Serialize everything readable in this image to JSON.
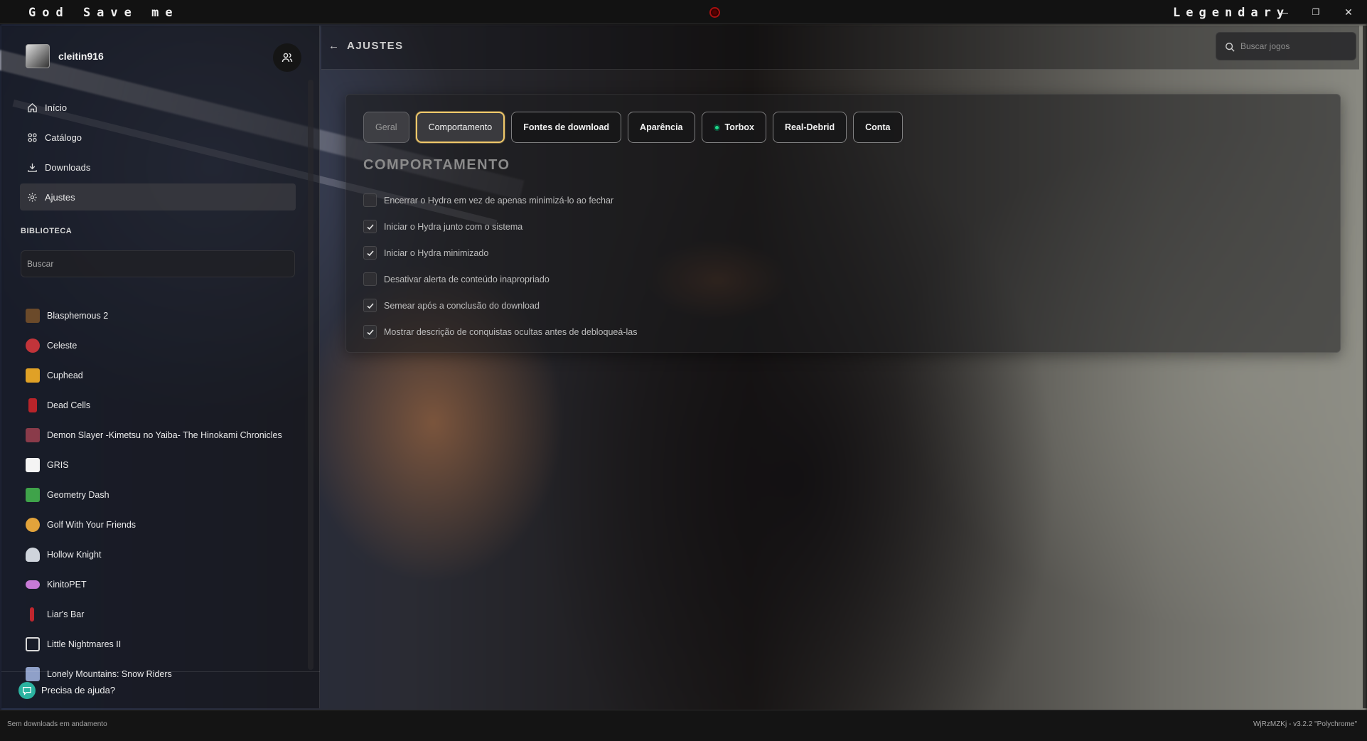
{
  "window": {
    "app_title": "God Save me",
    "theme_name": "Legendary",
    "minimize": "—",
    "maximize": "❐",
    "close": "✕"
  },
  "profile": {
    "username": "cleitin916"
  },
  "nav": {
    "items": [
      {
        "label": "Início",
        "icon": "home-icon"
      },
      {
        "label": "Catálogo",
        "icon": "grid-icon"
      },
      {
        "label": "Downloads",
        "icon": "download-icon"
      },
      {
        "label": "Ajustes",
        "icon": "gear-icon",
        "active": true
      }
    ]
  },
  "library": {
    "title": "BIBLIOTECA",
    "search_placeholder": "Buscar",
    "games": [
      {
        "name": "Blasphemous 2",
        "color": "#6b4a2a"
      },
      {
        "name": "Celeste",
        "color": "#c2343a"
      },
      {
        "name": "Cuphead",
        "color": "#e0a126"
      },
      {
        "name": "Dead Cells",
        "color": "#b8242a"
      },
      {
        "name": "Demon Slayer -Kimetsu no Yaiba- The Hinokami Chronicles",
        "color": "#8a3b4a"
      },
      {
        "name": "GRIS",
        "color": "#f4f4f4"
      },
      {
        "name": "Geometry Dash",
        "color": "#3fa34a"
      },
      {
        "name": "Golf With Your Friends",
        "color": "#e2a33b"
      },
      {
        "name": "Hollow Knight",
        "color": "#cfd4dc"
      },
      {
        "name": "KinitoPET",
        "color": "#c77ad6"
      },
      {
        "name": "Liar's Bar",
        "color": "#c0262e"
      },
      {
        "name": "Little Nightmares II",
        "color": "#d9d9d9"
      },
      {
        "name": "Lonely Mountains: Snow Riders",
        "color": "#8fa0c8"
      }
    ]
  },
  "help": {
    "label": "Precisa de ajuda?"
  },
  "header": {
    "back": "←",
    "title": "AJUSTES",
    "search_placeholder": "Buscar jogos"
  },
  "settings": {
    "tabs": [
      {
        "label": "Geral",
        "state": "disabled"
      },
      {
        "label": "Comportamento",
        "state": "active"
      },
      {
        "label": "Fontes de download",
        "state": "normal"
      },
      {
        "label": "Aparência",
        "state": "normal"
      },
      {
        "label": "Torbox",
        "state": "normal",
        "dot": true
      },
      {
        "label": "Real-Debrid",
        "state": "normal"
      },
      {
        "label": "Conta",
        "state": "normal"
      }
    ],
    "section_title": "COMPORTAMENTO",
    "options": [
      {
        "label": "Encerrar o Hydra em vez de apenas minimizá-lo ao fechar",
        "checked": false
      },
      {
        "label": "Iniciar o Hydra junto com o sistema",
        "checked": true
      },
      {
        "label": "Iniciar o Hydra minimizado",
        "checked": true
      },
      {
        "label": "Desativar alerta de conteúdo inapropriado",
        "checked": false
      },
      {
        "label": "Semear após a conclusão do download",
        "checked": true
      },
      {
        "label": "Mostrar descrição de conquistas ocultas antes de debloqueá-las",
        "checked": true
      }
    ]
  },
  "footer": {
    "status": "Sem downloads em andamento",
    "version": "WjRzMZKj - v3.2.2 \"Polychrome\""
  },
  "colors": {
    "accent_tab_border": "#f0c86a",
    "torbox_dot": "#1fd98a",
    "help_icon": "#2bb3a0"
  }
}
